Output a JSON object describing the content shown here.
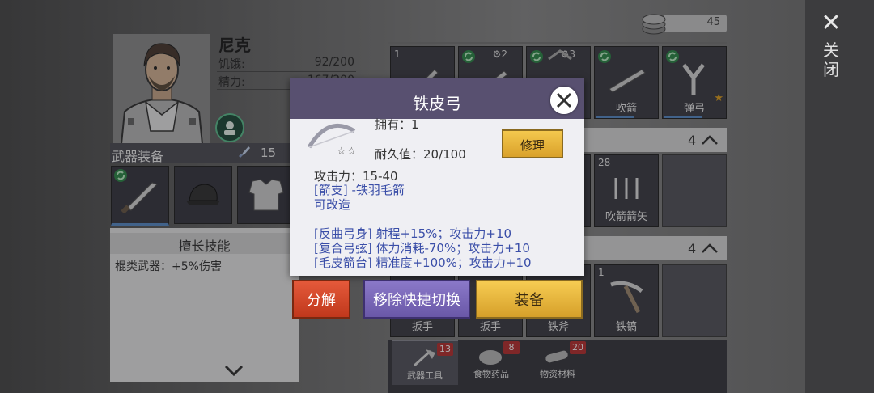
{
  "close_rail": {
    "label": "关闭"
  },
  "character": {
    "name": "尼克",
    "hunger_label": "饥饿:",
    "hunger_value": "92/200",
    "energy_label": "精力:",
    "energy_value": "167/200"
  },
  "weapon_section": {
    "title": "武器装备",
    "count": "15"
  },
  "skills": {
    "title": "擅长技能",
    "line": "棍类武器：+5%伤害"
  },
  "currency": {
    "count": "45"
  },
  "inventory": {
    "row1": [
      {
        "num": "1",
        "label": ""
      },
      {
        "num": "",
        "label": "",
        "gear": "2"
      },
      {
        "num": "",
        "label": "",
        "gear": "3"
      },
      {
        "num": "",
        "label": "吹箭"
      },
      {
        "num": "",
        "label": "弹弓"
      }
    ],
    "section2_count": "4",
    "row2": [
      {
        "num": "28",
        "label": "吹箭箭矢"
      }
    ],
    "section3_count": "4",
    "row3": [
      {
        "num": "",
        "label": "扳手"
      },
      {
        "num": "",
        "label": "扳手"
      },
      {
        "num": "",
        "label": "铁斧"
      },
      {
        "num": "1",
        "label": "铁镐"
      }
    ]
  },
  "tabs": [
    {
      "label": "武器工具",
      "badge": "13"
    },
    {
      "label": "食物药品",
      "badge": "8"
    },
    {
      "label": "物资材料",
      "badge": "20"
    }
  ],
  "modal": {
    "title": "铁皮弓",
    "owned": "拥有：1",
    "durability": "耐久值：20/100",
    "repair": "修理",
    "attack": "攻击力：15-40",
    "arrow_type": "[箭支] -铁羽毛箭",
    "modifiable": "可改造",
    "mods": [
      "[反曲弓身] 射程+15%；攻击力+10",
      "[复合弓弦] 体力消耗-70%；攻击力+10",
      "[毛皮箭台] 精准度+100%；攻击力+10"
    ],
    "stars": "☆☆"
  },
  "actions": {
    "decompose": "分解",
    "remove_quick": "移除快捷切换",
    "equip": "装备"
  },
  "colors": {
    "modal_header": "#585070",
    "accent_gold": "#e0b040",
    "accent_red": "#d04828",
    "accent_purple": "#7a68b8",
    "link_blue": "#3a4ea8"
  }
}
